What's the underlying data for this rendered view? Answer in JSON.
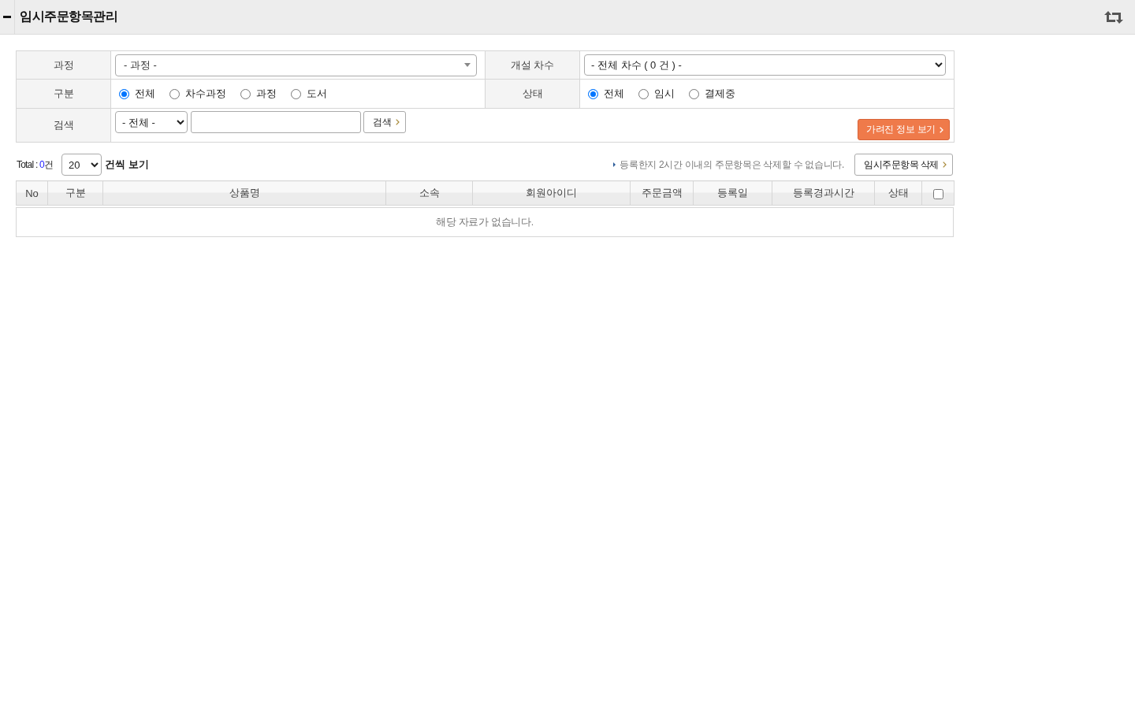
{
  "header": {
    "title": "임시주문항목관리"
  },
  "filters": {
    "course": {
      "label": "과정",
      "value": "- 과정 -"
    },
    "session": {
      "label": "개설 차수",
      "value": "- 전체 차수 ( 0 건 ) -"
    },
    "category": {
      "label": "구분",
      "options": [
        {
          "label": "전체",
          "selected": true
        },
        {
          "label": "차수과정",
          "selected": false
        },
        {
          "label": "과정",
          "selected": false
        },
        {
          "label": "도서",
          "selected": false
        }
      ]
    },
    "status": {
      "label": "상태",
      "options": [
        {
          "label": "전체",
          "selected": true
        },
        {
          "label": "임시",
          "selected": false
        },
        {
          "label": "결제중",
          "selected": false
        }
      ]
    },
    "search": {
      "label": "검색",
      "field": "- 전체 -",
      "button": "검색"
    },
    "hidden_info_button": "가려진 정보 보기"
  },
  "list_bar": {
    "total_label": "Total : ",
    "total_count": "0",
    "total_unit": "건",
    "page_size": "20",
    "page_size_suffix": "건씩 보기",
    "notice": "등록한지 2시간 이내의 주문항목은 삭제할 수 없습니다.",
    "delete_button": "임시주문항목 삭제"
  },
  "table": {
    "columns": [
      "No",
      "구분",
      "상품명",
      "소속",
      "회원아이디",
      "주문금액",
      "등록일",
      "등록경과시간",
      "상태"
    ],
    "select_all_checked": false,
    "empty_message": "해당 자료가 없습니다."
  }
}
